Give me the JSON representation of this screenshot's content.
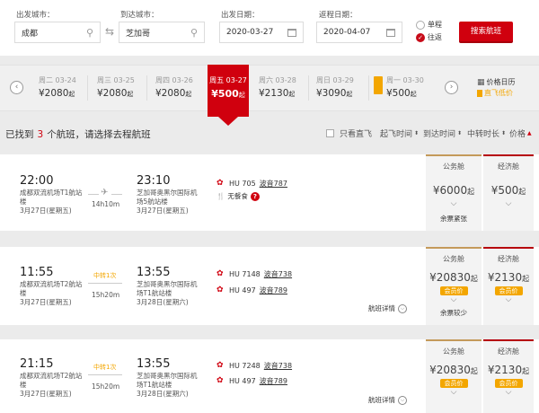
{
  "search": {
    "from_label": "出发城市：",
    "from_value": "成都",
    "to_label": "到达城市：",
    "to_value": "芝加哥",
    "depart_label": "出发日期：",
    "depart_value": "2020-03-27",
    "return_label": "返程日期：",
    "return_value": "2020-04-07",
    "one_way": "单程",
    "round_trip": "往返",
    "search_button": "搜索航班"
  },
  "date_strip": {
    "days": [
      {
        "date": "周二 03-24",
        "price": "¥2080",
        "unit": "起"
      },
      {
        "date": "周三 03-25",
        "price": "¥2080",
        "unit": "起"
      },
      {
        "date": "周四 03-26",
        "price": "¥2080",
        "unit": "起"
      },
      {
        "date": "周五 03-27",
        "price": "¥500",
        "unit": "起"
      },
      {
        "date": "周六 03-28",
        "price": "¥2130",
        "unit": "起"
      },
      {
        "date": "周日 03-29",
        "price": "¥3090",
        "unit": "起"
      },
      {
        "date": "周一 03-30",
        "price": "¥500",
        "unit": "起"
      }
    ],
    "calendar_label": "价格日历",
    "direct_label": "直飞低价"
  },
  "results": {
    "prefix": "已找到",
    "count": "3",
    "suffix": "个航班，请选择去程航班",
    "direct_only": "只看直飞",
    "sort_depart": "起飞时间",
    "sort_arrive": "到达时间",
    "sort_transfer": "中转时长",
    "sort_price": "价格"
  },
  "flights": [
    {
      "dep_time": "22:00",
      "dep_airport": "成都双流机场T1航站楼",
      "dep_date": "3月27日(星期五)",
      "transfer": "",
      "duration": "14h10m",
      "arr_time": "23:10",
      "arr_airport": "芝加哥奥黑尔国际机场5航站楼",
      "arr_date": "3月27日(星期五)",
      "segments": [
        {
          "code": "HU 705",
          "plane": "波音787"
        }
      ],
      "meal": "无餐食",
      "detail": "",
      "business": {
        "label": "公务舱",
        "price": "¥6000",
        "unit": "起",
        "member": "",
        "remark": "余票紧张"
      },
      "economy": {
        "label": "经济舱",
        "price": "¥500",
        "unit": "起",
        "member": "",
        "remark": ""
      }
    },
    {
      "dep_time": "11:55",
      "dep_airport": "成都双流机场T2航站楼",
      "dep_date": "3月27日(星期五)",
      "transfer": "中转1次",
      "duration": "15h20m",
      "arr_time": "13:55",
      "arr_airport": "芝加哥奥黑尔国际机场T1航站楼",
      "arr_date": "3月28日(星期六)",
      "segments": [
        {
          "code": "HU 7148",
          "plane": "波音738"
        },
        {
          "code": "HU 497",
          "plane": "波音789"
        }
      ],
      "meal": "",
      "detail": "航班详情",
      "business": {
        "label": "公务舱",
        "price": "¥20830",
        "unit": "起",
        "member": "会员价",
        "remark": "余票较少"
      },
      "economy": {
        "label": "经济舱",
        "price": "¥2130",
        "unit": "起",
        "member": "会员价",
        "remark": ""
      }
    },
    {
      "dep_time": "21:15",
      "dep_airport": "成都双流机场T2航站楼",
      "dep_date": "3月27日(星期五)",
      "transfer": "中转1次",
      "duration": "15h20m",
      "arr_time": "13:55",
      "arr_airport": "芝加哥奥黑尔国际机场T1航站楼",
      "arr_date": "3月28日(星期六)",
      "segments": [
        {
          "code": "HU 7248",
          "plane": "波音738"
        },
        {
          "code": "HU 497",
          "plane": "波音789"
        }
      ],
      "meal": "",
      "detail": "航班详情",
      "business": {
        "label": "公务舱",
        "price": "¥20830",
        "unit": "起",
        "member": "会员价",
        "remark": ""
      },
      "economy": {
        "label": "经济舱",
        "price": "¥2130",
        "unit": "起",
        "member": "会员价",
        "remark": ""
      }
    }
  ],
  "colors": {
    "accent": "#d0000e",
    "member": "#f3a600",
    "business_top": "#c49a5a"
  }
}
